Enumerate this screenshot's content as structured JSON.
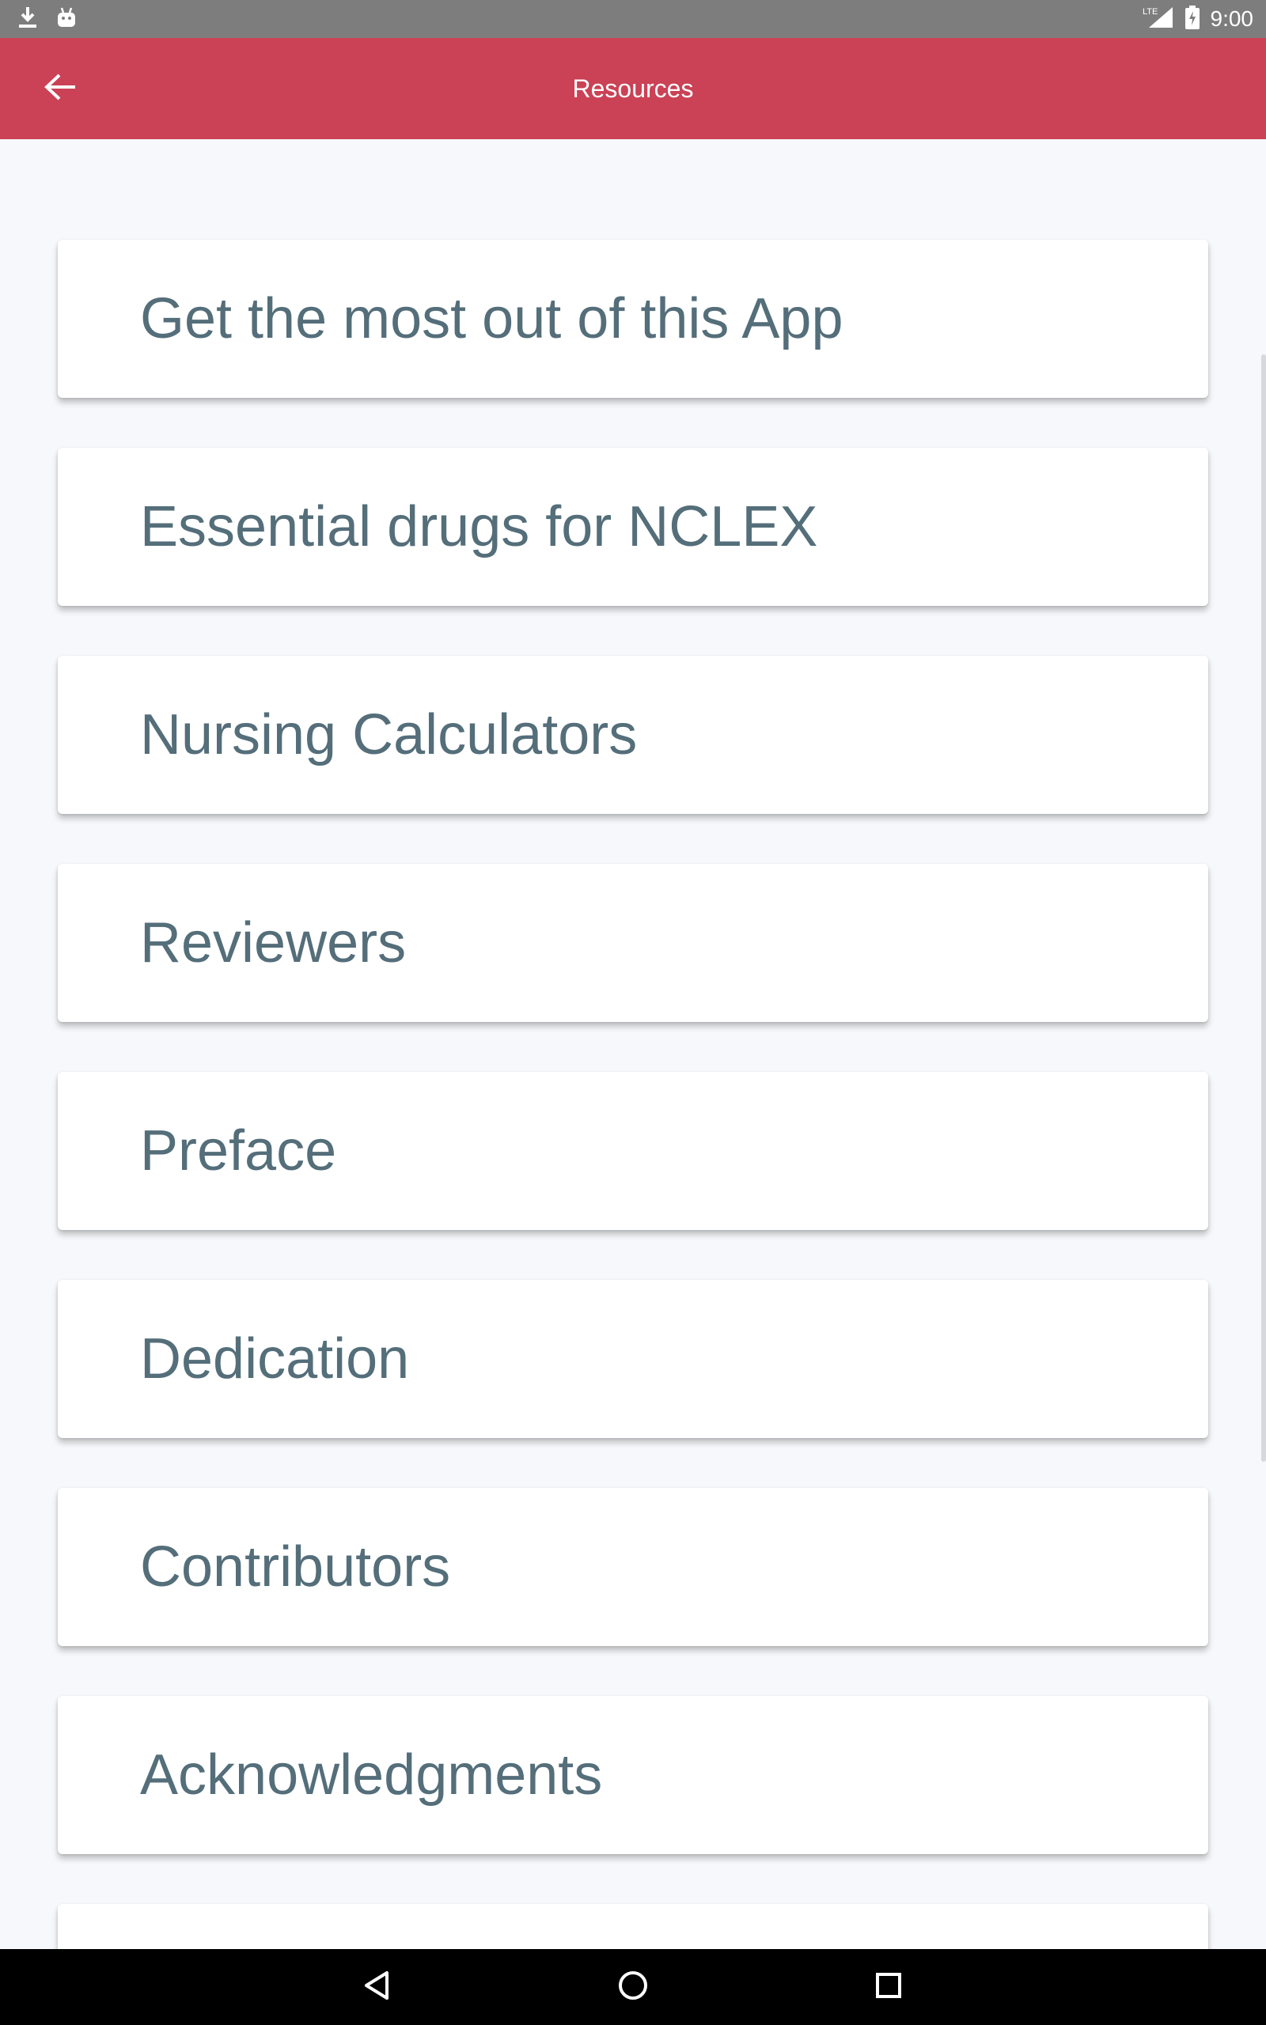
{
  "status_bar": {
    "time": "9:00",
    "left_icons": [
      "download-icon",
      "android-debug-icon"
    ],
    "right_icons": [
      "lte-signal-icon",
      "battery-charging-icon"
    ],
    "network_label": "LTE"
  },
  "app_bar": {
    "title": "Resources",
    "back_icon": "arrow-back-icon",
    "color": "#cb4155"
  },
  "resources": {
    "items": [
      {
        "label": "Get the most out of this App"
      },
      {
        "label": "Essential drugs for NCLEX"
      },
      {
        "label": "Nursing Calculators"
      },
      {
        "label": "Reviewers"
      },
      {
        "label": "Preface"
      },
      {
        "label": "Dedication"
      },
      {
        "label": "Contributors"
      },
      {
        "label": "Acknowledgments"
      },
      {
        "label": ""
      }
    ],
    "text_color": "#546e7a"
  },
  "nav_bar": {
    "buttons": [
      "back-triangle-icon",
      "home-circle-icon",
      "recents-square-icon"
    ]
  }
}
